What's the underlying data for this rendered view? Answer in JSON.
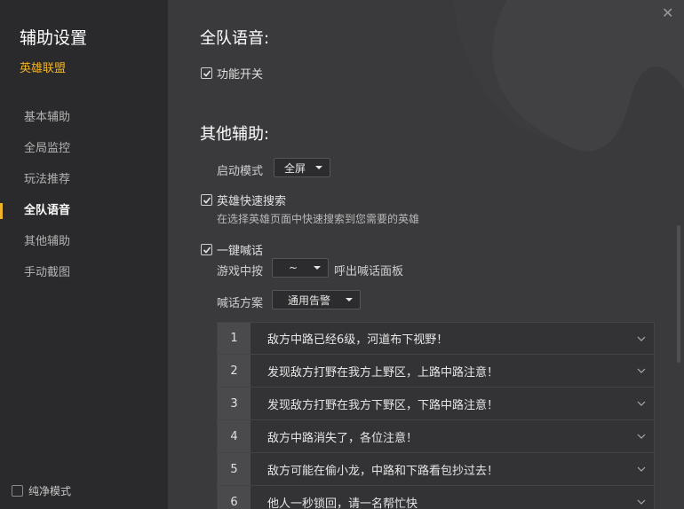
{
  "sidebar": {
    "title": "辅助设置",
    "game": "英雄联盟",
    "items": [
      {
        "label": "基本辅助"
      },
      {
        "label": "全局监控"
      },
      {
        "label": "玩法推荐"
      },
      {
        "label": "全队语音",
        "active": true
      },
      {
        "label": "其他辅助"
      },
      {
        "label": "手动截图"
      }
    ],
    "pure_mode": "纯净模式"
  },
  "team_voice": {
    "title": "全队语音:",
    "toggle_label": "功能开关"
  },
  "other": {
    "title": "其他辅助:",
    "launch_mode_label": "启动模式",
    "launch_mode_value": "全屏",
    "hero_search_label": "英雄快速搜索",
    "hero_search_desc": "在选择英雄页面中快速搜索到您需要的英雄",
    "shout_label": "一键喊话",
    "in_game_label": "游戏中按",
    "hotkey_value": "~",
    "hotkey_suffix": "呼出喊话面板",
    "plan_label": "喊话方案",
    "plan_value": "通用告警",
    "messages": [
      {
        "num": "1",
        "text": "敌方中路已经6级，河道布下视野！"
      },
      {
        "num": "2",
        "text": "发现敌方打野在我方上野区，上路中路注意！"
      },
      {
        "num": "3",
        "text": "发现敌方打野在我方下野区，下路中路注意！"
      },
      {
        "num": "4",
        "text": "敌方中路消失了，各位注意！"
      },
      {
        "num": "5",
        "text": "敌方可能在偷小龙，中路和下路看包抄过去！"
      },
      {
        "num": "6",
        "text": "他人一秒锁回，请一名帮忙快"
      }
    ]
  }
}
